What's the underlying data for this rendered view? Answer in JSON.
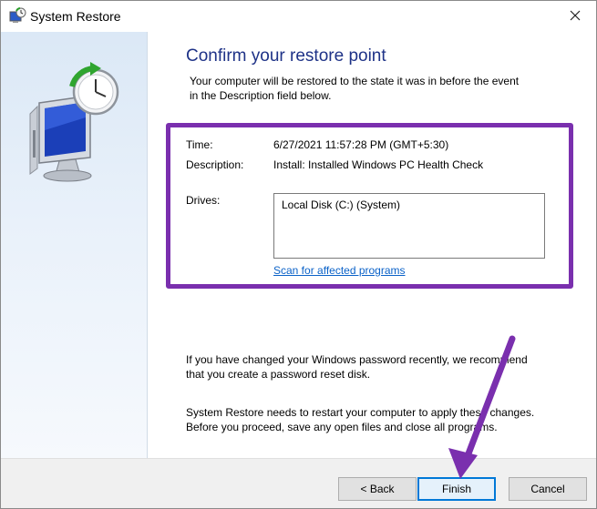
{
  "window": {
    "title": "System Restore",
    "close_icon": "close-icon",
    "title_icon": "system-restore-icon"
  },
  "page": {
    "heading": "Confirm your restore point",
    "intro_line1": "Your computer will be restored to the state it was in before the event",
    "intro_line2": "in the Description field below."
  },
  "details": {
    "time_label": "Time:",
    "time_value": "6/27/2021 11:57:28 PM (GMT+5:30)",
    "description_label": "Description:",
    "description_value": "Install: Installed Windows PC Health Check",
    "drives_label": "Drives:",
    "drives": [
      "Local Disk (C:) (System)"
    ],
    "scan_link": "Scan for affected programs"
  },
  "notes": {
    "password_line1": "If you have changed your Windows password recently, we recommend",
    "password_line2": "that you create a password reset disk.",
    "restart_line1": "System Restore needs to restart your computer to apply these changes.",
    "restart_line2": "Before you proceed, save any open files and close all programs."
  },
  "buttons": {
    "back": "< Back",
    "finish": "Finish",
    "cancel": "Cancel"
  },
  "colors": {
    "highlight": "#7a2fae",
    "heading": "#1e3287",
    "link": "#0b62c8",
    "default_button_border": "#0078d7"
  }
}
